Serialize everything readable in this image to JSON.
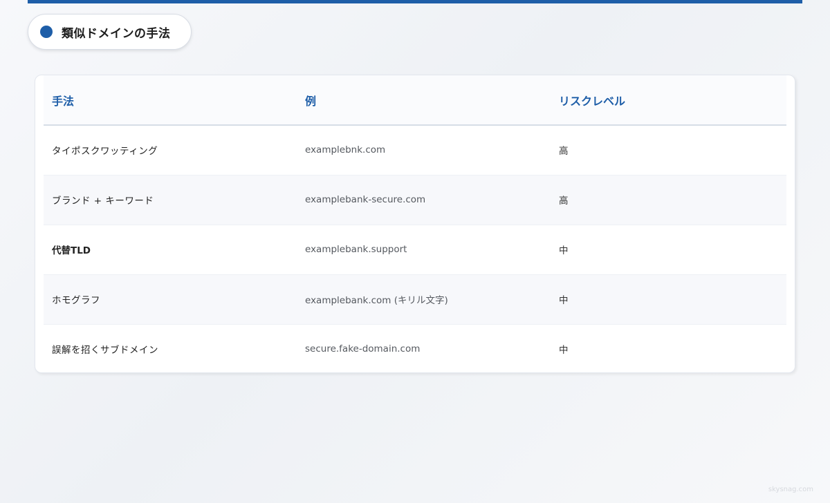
{
  "header": {
    "title": "類似ドメインの手法",
    "accent_color": "#1e5ea8"
  },
  "table": {
    "columns": [
      "手法",
      "例",
      "リスクレベル"
    ],
    "rows": [
      {
        "method": "タイポスクワッティング",
        "example": "examplebnk.com",
        "risk": "高"
      },
      {
        "method": "ブランド + キーワード",
        "example": "examplebank-secure.com",
        "risk": "高"
      },
      {
        "method": "代替TLD",
        "example": "examplebank.support",
        "risk": "中"
      },
      {
        "method": "ホモグラフ",
        "example": "examplebank.com (キリル文字)",
        "risk": "中"
      },
      {
        "method": "誤解を招くサブドメイン",
        "example": "secure.fake-domain.com",
        "risk": "中"
      }
    ]
  },
  "footer": {
    "watermark": "skysnag.com"
  }
}
